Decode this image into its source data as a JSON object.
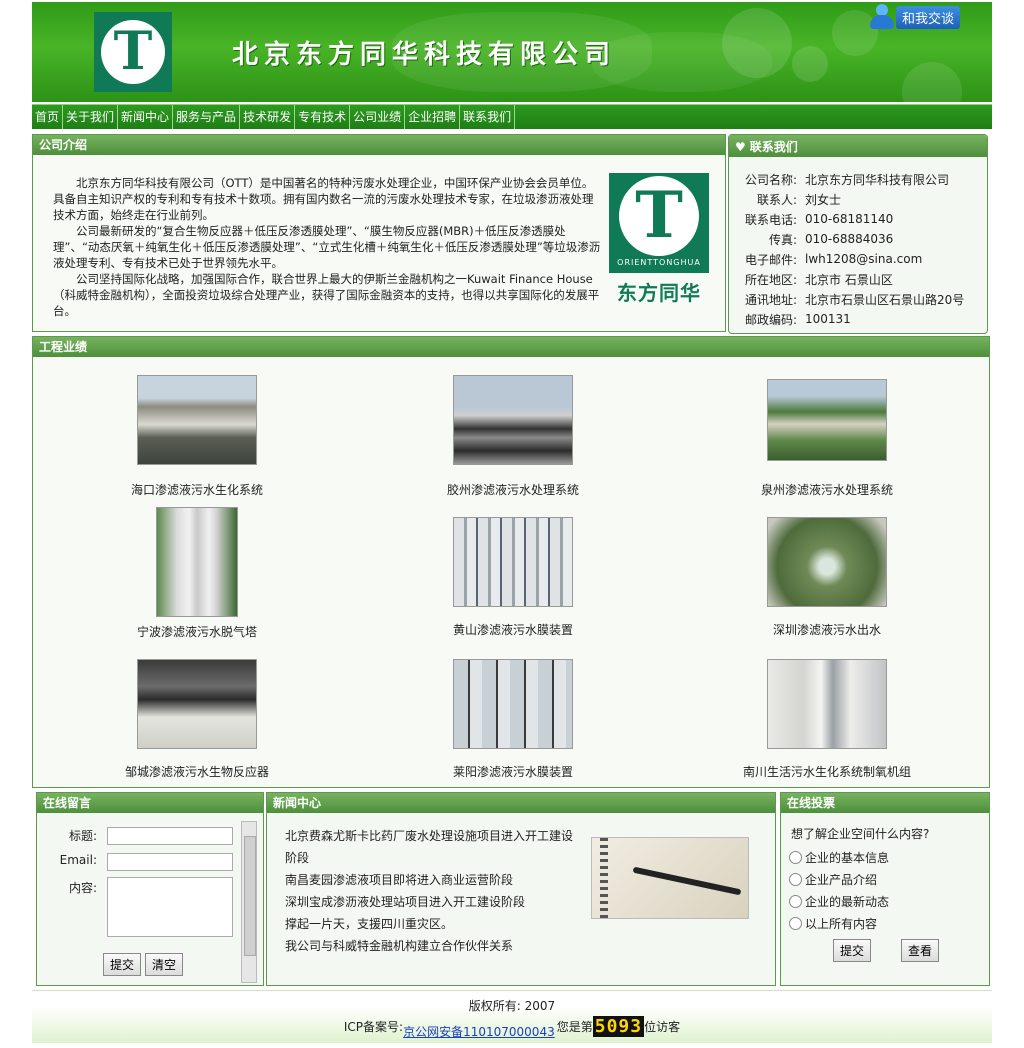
{
  "header": {
    "title": "北京东方同华科技有限公司",
    "chat_label": "和我交谈",
    "logo_letter": "T"
  },
  "nav": [
    "首页",
    "关于我们",
    "新闻中心",
    "服务与产品",
    "技术研发",
    "专有技术",
    "公司业绩",
    "企业招聘",
    "联系我们"
  ],
  "intro": {
    "title": "公司介绍",
    "paragraphs": [
      "北京东方同华科技有限公司（OTT）是中国著名的特种污废水处理企业，中国环保产业协会会员单位。具备自主知识产权的专利和专有技术十数项。拥有国内数名一流的污废水处理技术专家，在垃圾渗沥液处理技术方面，始终走在行业前列。",
      "公司最新研发的“复合生物反应器＋低压反渗透膜处理”、“膜生物反应器(MBR)＋低压反渗透膜处理”、“动态厌氧＋纯氧生化＋低压反渗透膜处理”、“立式生化槽＋纯氧生化＋低压反渗透膜处理”等垃圾渗沥液处理专利、专有技术已处于世界领先水平。",
      "公司坚持国际化战略，加强国际合作，联合世界上最大的伊斯兰金融机构之一Kuwait Finance House（科威特金融机构），全面投资垃圾综合处理产业，获得了国际金融资本的支持，也得以共享国际化的发展平台。"
    ],
    "logo_en": "ORIENTTONGHUA",
    "logo_cn": "东方同华"
  },
  "contact": {
    "title": "联系我们",
    "rows": [
      {
        "k": "公司名称:",
        "v": "北京东方同华科技有限公司"
      },
      {
        "k": "联系人:",
        "v": "刘女士"
      },
      {
        "k": "联系电话:",
        "v": "010-68181140"
      },
      {
        "k": "传真:",
        "v": "010-68884036"
      },
      {
        "k": "电子邮件:",
        "v": "lwh1208@sina.com"
      },
      {
        "k": "所在地区:",
        "v": "北京市 石景山区"
      },
      {
        "k": "通讯地址:",
        "v": "北京市石景山区石景山路20号"
      },
      {
        "k": "邮政编码:",
        "v": "100131"
      }
    ]
  },
  "projects": {
    "title": "工程业绩",
    "items": [
      "海口渗滤液污水生化系统",
      "胶州渗滤液污水处理系统",
      "泉州渗滤液污水处理系统",
      "宁波渗滤液污水脱气塔",
      "黄山渗滤液污水膜装置",
      "深圳渗滤液污水出水",
      "邹城渗滤液污水生物反应器",
      "莱阳渗滤液污水膜装置",
      "南川生活污水生化系统制氧机组"
    ]
  },
  "message": {
    "title": "在线留言",
    "label_title": "标题:",
    "label_email": "Email:",
    "label_content": "内容:",
    "submit": "提交",
    "clear": "清空"
  },
  "news": {
    "title": "新闻中心",
    "items": [
      "北京费森尤斯卡比药厂废水处理设施项目进入开工建设阶段",
      "南昌麦园渗滤液项目即将进入商业运营阶段",
      "深圳宝成渗沥液处理站项目进入开工建设阶段",
      "撑起一片天，支援四川重灾区。",
      "我公司与科威特金融机构建立合作伙伴关系"
    ]
  },
  "vote": {
    "title": "在线投票",
    "question": "想了解企业空间什么内容?",
    "options": [
      "企业的基本信息",
      "企业产品介绍",
      "企业的最新动态",
      "以上所有内容"
    ],
    "submit": "提交",
    "view": "查看"
  },
  "footer": {
    "copyright": "版权所有: 2007",
    "icp_label": "ICP备案号:",
    "icp_link": "京公网安备110107000043",
    "visitor_prefix": "您是第",
    "visitor_count": "5093",
    "visitor_suffix": "位访客"
  }
}
